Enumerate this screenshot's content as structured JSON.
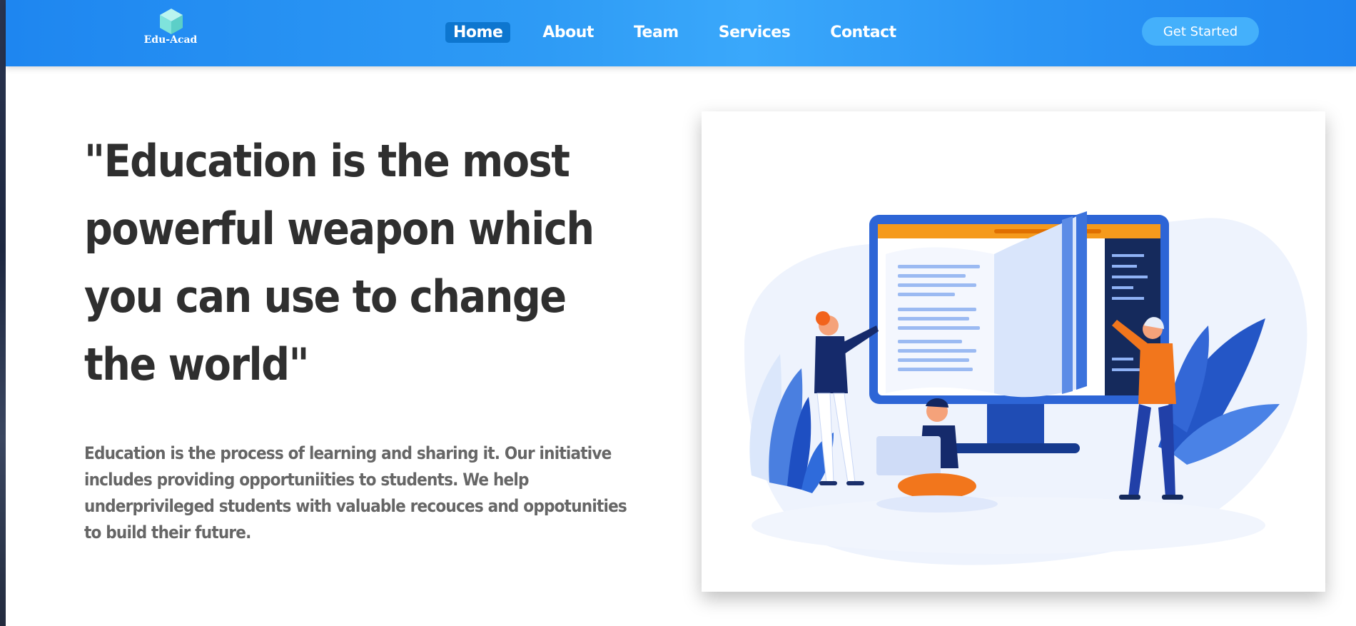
{
  "brand": {
    "name": "Edu-Acad",
    "icon": "cube-icon"
  },
  "nav": {
    "items": [
      {
        "label": "Home",
        "active": true
      },
      {
        "label": "About",
        "active": false
      },
      {
        "label": "Team",
        "active": false
      },
      {
        "label": "Services",
        "active": false
      },
      {
        "label": "Contact",
        "active": false
      }
    ],
    "cta_label": "Get Started"
  },
  "hero": {
    "quote": "\"Education is the most powerful weapon which you can use to change the world\"",
    "description": "Education is the process of learning and sharing it. Our initiative includes providing opportuniities to students. We help underprivileged students with valuable recouces and oppotunities to build their future.",
    "illustration": "education-illustration"
  },
  "colors": {
    "nav_gradient_start": "#1e86f0",
    "nav_gradient_end": "#3aa8fb",
    "active_nav_bg": "#0d76cf",
    "cta_bg": "#44b0fb",
    "quote_text": "#2f2f2f",
    "description_text": "#666666"
  }
}
